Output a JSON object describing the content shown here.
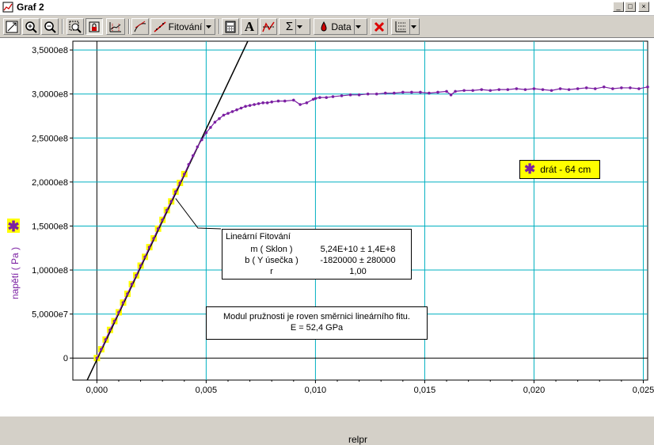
{
  "window": {
    "title": "Graf 2",
    "min": "_",
    "max": "□",
    "close": "×"
  },
  "toolbar": {
    "fit_label": "Fitování",
    "data_label": "Data",
    "sum_label": "Σ",
    "text_tool": "A"
  },
  "chart_data": {
    "type": "scatter",
    "title": "",
    "xlabel": "relpr",
    "ylabel": "napětí ( Pa )",
    "xlim": [
      -0.0011,
      0.0252
    ],
    "ylim": [
      -25000000.0,
      360000000.0
    ],
    "xticks": [
      0.0,
      0.005,
      0.01,
      0.015,
      0.02,
      0.025
    ],
    "xtick_labels": [
      "0,000",
      "0,005",
      "0,010",
      "0,015",
      "0,020",
      "0,025"
    ],
    "yticks": [
      0,
      50000000.0,
      100000000.0,
      150000000.0,
      200000000.0,
      250000000.0,
      300000000.0,
      350000000.0
    ],
    "ytick_labels": [
      "0",
      "5,0000e7",
      "1,0000e8",
      "1,5000e8",
      "2,0000e8",
      "2,5000e8",
      "3,0000e8",
      "3,5000e8"
    ],
    "grid": true,
    "series": [
      {
        "name": "drát - 64 cm",
        "color": "#7b1fa2",
        "x": [
          0.0,
          0.0002,
          0.0004,
          0.0006,
          0.0008,
          0.001,
          0.0012,
          0.0014,
          0.0016,
          0.0018,
          0.002,
          0.0022,
          0.0024,
          0.0026,
          0.0028,
          0.003,
          0.0032,
          0.0034,
          0.0036,
          0.0038,
          0.004,
          0.0042,
          0.0044,
          0.0046,
          0.0048,
          0.005,
          0.0052,
          0.0054,
          0.0056,
          0.0058,
          0.006,
          0.0062,
          0.0064,
          0.0066,
          0.0068,
          0.007,
          0.0072,
          0.0074,
          0.0076,
          0.0078,
          0.008,
          0.0083,
          0.0086,
          0.009,
          0.0093,
          0.0096,
          0.0099,
          0.01,
          0.0102,
          0.0105,
          0.0108,
          0.0112,
          0.0116,
          0.012,
          0.0124,
          0.0128,
          0.0132,
          0.0136,
          0.014,
          0.0144,
          0.0148,
          0.0152,
          0.0156,
          0.016,
          0.0162,
          0.0164,
          0.0168,
          0.0172,
          0.0176,
          0.018,
          0.0184,
          0.0188,
          0.0192,
          0.0196,
          0.02,
          0.0204,
          0.0208,
          0.0212,
          0.0216,
          0.022,
          0.0224,
          0.0228,
          0.0232,
          0.0236,
          0.024,
          0.0244,
          0.0248,
          0.0252
        ],
        "y": [
          0.0,
          10000000.0,
          21000000.0,
          32000000.0,
          42000000.0,
          52000000.0,
          63000000.0,
          73000000.0,
          84000000.0,
          94000000.0,
          105000000.0,
          115000000.0,
          126000000.0,
          136000000.0,
          147000000.0,
          157000000.0,
          168000000.0,
          178000000.0,
          189000000.0,
          199000000.0,
          209000000.0,
          220000000.0,
          230000000.0,
          240000000.0,
          248000000.0,
          256000000.0,
          262000000.0,
          268000000.0,
          272000000.0,
          276000000.0,
          278000000.0,
          280000000.0,
          282000000.0,
          284000000.0,
          286000000.0,
          287000000.0,
          288000000.0,
          289000000.0,
          290000000.0,
          290000000.0,
          291000000.0,
          292000000.0,
          292000000.0,
          293000000.0,
          288000000.0,
          290000000.0,
          294000000.0,
          295000000.0,
          296000000.0,
          296000000.0,
          297000000.0,
          298000000.0,
          299000000.0,
          299000000.0,
          300000000.0,
          300000000.0,
          301000000.0,
          301000000.0,
          302000000.0,
          302000000.0,
          302000000.0,
          301000000.0,
          302000000.0,
          303000000.0,
          299000000.0,
          303000000.0,
          304000000.0,
          304000000.0,
          305000000.0,
          304000000.0,
          305000000.0,
          305000000.0,
          306000000.0,
          305000000.0,
          306000000.0,
          305000000.0,
          304000000.0,
          306000000.0,
          305000000.0,
          306000000.0,
          307000000.0,
          306000000.0,
          308000000.0,
          306000000.0,
          307000000.0,
          307000000.0,
          306000000.0,
          308000000.0
        ]
      }
    ],
    "fit": {
      "title": "Lineární Fitování",
      "rows": [
        {
          "label": "m ( Sklon )",
          "value": "5,24E+10 ±  1,4E+8"
        },
        {
          "label": "b ( Y úsečka )",
          "value": "-1820000 ± 280000"
        },
        {
          "label": "r",
          "value": "1,00"
        }
      ],
      "slope": 52400000000,
      "intercept": -1820000,
      "fit_range_x": [
        0.0,
        0.004
      ]
    },
    "note": {
      "line1": "Modul pružnosti je roven směrnici lineárního fitu.",
      "line2": "E = 52,4 GPa"
    },
    "legend": {
      "star": "✱",
      "label": "drát - 64 cm",
      "placement": "right"
    },
    "colors": {
      "series": "#7b1fa2",
      "highlight": "#ffff00",
      "grid": "#00b0c0",
      "fit_line": "#000000"
    }
  }
}
